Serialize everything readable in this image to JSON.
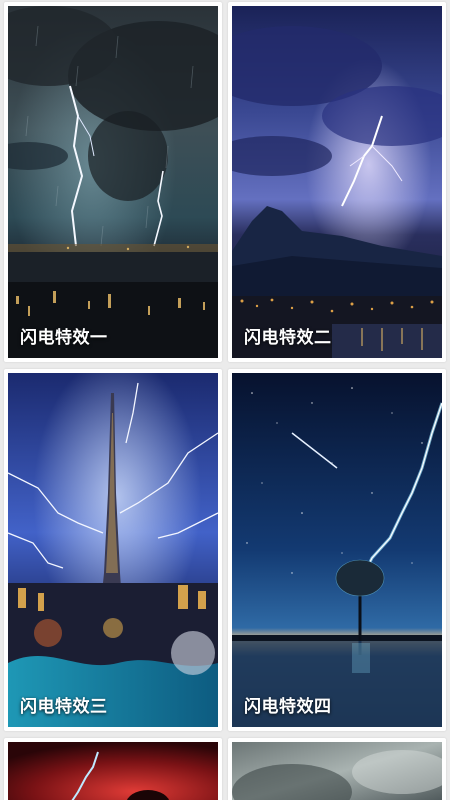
{
  "wallpapers": [
    {
      "title": "闪电特效一"
    },
    {
      "title": "闪电特效二"
    },
    {
      "title": "闪电特效三"
    },
    {
      "title": "闪电特效四"
    }
  ],
  "colors": {
    "background": "#ebebeb",
    "card": "#ffffff",
    "label": "#ffffff"
  }
}
